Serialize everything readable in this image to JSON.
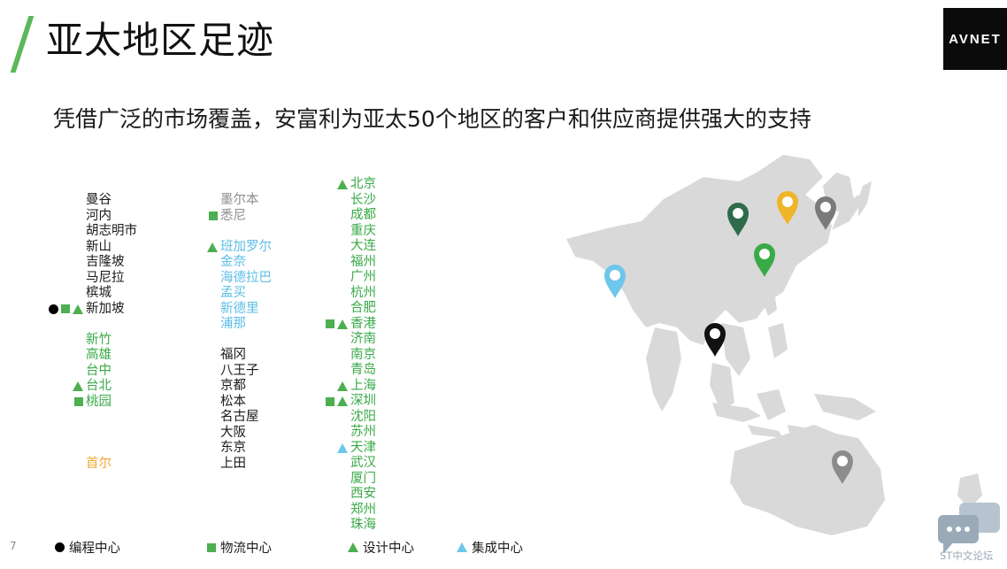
{
  "slide": {
    "title": "亚太地区足迹",
    "subtitle": "凭借广泛的市场覆盖，安富利为亚太50个地区的客户和供应商提供强大的支持",
    "logo": "AVNET",
    "page_number": "7"
  },
  "colors": {
    "accent_green": "#5cb85c",
    "logistics_green": "#4caf50",
    "integration_blue": "#6ec6ea",
    "seoul_orange": "#f0a830"
  },
  "columns": [
    {
      "groups": [
        {
          "color": "black",
          "cities": [
            {
              "name": "曼谷",
              "marks": []
            },
            {
              "name": "河内",
              "marks": []
            },
            {
              "name": "胡志明市",
              "marks": []
            },
            {
              "name": "新山",
              "marks": []
            },
            {
              "name": "吉隆坡",
              "marks": []
            },
            {
              "name": "马尼拉",
              "marks": []
            },
            {
              "name": "槟城",
              "marks": []
            },
            {
              "name": "新加坡",
              "marks": [
                "dot",
                "square",
                "triangle"
              ]
            }
          ]
        },
        {
          "color": "green",
          "cities": [
            {
              "name": "新竹",
              "marks": []
            },
            {
              "name": "高雄",
              "marks": []
            },
            {
              "name": "台中",
              "marks": []
            },
            {
              "name": "台北",
              "marks": [
                "triangle"
              ]
            },
            {
              "name": "桃园",
              "marks": [
                "square"
              ]
            }
          ]
        },
        {
          "color": "orange",
          "cities": [
            {
              "name": "首尔",
              "marks": []
            }
          ]
        }
      ]
    },
    {
      "groups": [
        {
          "color": "gray",
          "cities": [
            {
              "name": "墨尔本",
              "marks": []
            },
            {
              "name": "悉尼",
              "marks": [
                "square"
              ]
            }
          ]
        },
        {
          "color": "blue",
          "cities": [
            {
              "name": "班加罗尔",
              "marks": [
                "triangle"
              ]
            },
            {
              "name": "金奈",
              "marks": []
            },
            {
              "name": "海德拉巴",
              "marks": []
            },
            {
              "name": "孟买",
              "marks": []
            },
            {
              "name": "新德里",
              "marks": []
            },
            {
              "name": "浦那",
              "marks": []
            }
          ]
        },
        {
          "color": "black",
          "cities": [
            {
              "name": "福冈",
              "marks": []
            },
            {
              "name": "八王子",
              "marks": []
            },
            {
              "name": "京都",
              "marks": []
            },
            {
              "name": "松本",
              "marks": []
            },
            {
              "name": "名古屋",
              "marks": []
            },
            {
              "name": "大阪",
              "marks": []
            },
            {
              "name": "东京",
              "marks": []
            },
            {
              "name": "上田",
              "marks": []
            }
          ]
        }
      ]
    },
    {
      "groups": [
        {
          "color": "green",
          "cities": [
            {
              "name": "北京",
              "marks": [
                "triangle"
              ]
            },
            {
              "name": "长沙",
              "marks": []
            },
            {
              "name": "成都",
              "marks": []
            },
            {
              "name": "重庆",
              "marks": []
            },
            {
              "name": "大连",
              "marks": []
            },
            {
              "name": "福州",
              "marks": []
            },
            {
              "name": "广州",
              "marks": []
            },
            {
              "name": "杭州",
              "marks": []
            },
            {
              "name": "合肥",
              "marks": []
            },
            {
              "name": "香港",
              "marks": [
                "square",
                "triangle"
              ]
            },
            {
              "name": "济南",
              "marks": []
            },
            {
              "name": "南京",
              "marks": []
            },
            {
              "name": "青岛",
              "marks": []
            },
            {
              "name": "上海",
              "marks": [
                "triangle"
              ]
            },
            {
              "name": "深圳",
              "marks": [
                "square",
                "triangle"
              ]
            },
            {
              "name": "沈阳",
              "marks": []
            },
            {
              "name": "苏州",
              "marks": []
            },
            {
              "name": "天津",
              "marks": [
                "triangle-blue"
              ]
            },
            {
              "name": "武汉",
              "marks": []
            },
            {
              "name": "厦门",
              "marks": []
            },
            {
              "name": "西安",
              "marks": []
            },
            {
              "name": "郑州",
              "marks": []
            },
            {
              "name": "珠海",
              "marks": []
            }
          ]
        }
      ]
    }
  ],
  "legend": [
    {
      "symbol": "dot",
      "label": "编程中心"
    },
    {
      "symbol": "square",
      "label": "物流中心"
    },
    {
      "symbol": "triangle",
      "label": "设计中心"
    },
    {
      "symbol": "triangle-blue",
      "label": "集成中心"
    }
  ],
  "map": {
    "pins": [
      {
        "region": "india",
        "color": "#6ec6ea"
      },
      {
        "region": "northern-china",
        "color": "#2e6b4a"
      },
      {
        "region": "korea",
        "color": "#f0b429"
      },
      {
        "region": "japan",
        "color": "#7a7a7a"
      },
      {
        "region": "eastern-china",
        "color": "#3aaa48"
      },
      {
        "region": "southeast-asia",
        "color": "#111111"
      },
      {
        "region": "australia",
        "color": "#8c8c8c"
      }
    ]
  },
  "watermark": {
    "text": "ST中文论坛"
  }
}
